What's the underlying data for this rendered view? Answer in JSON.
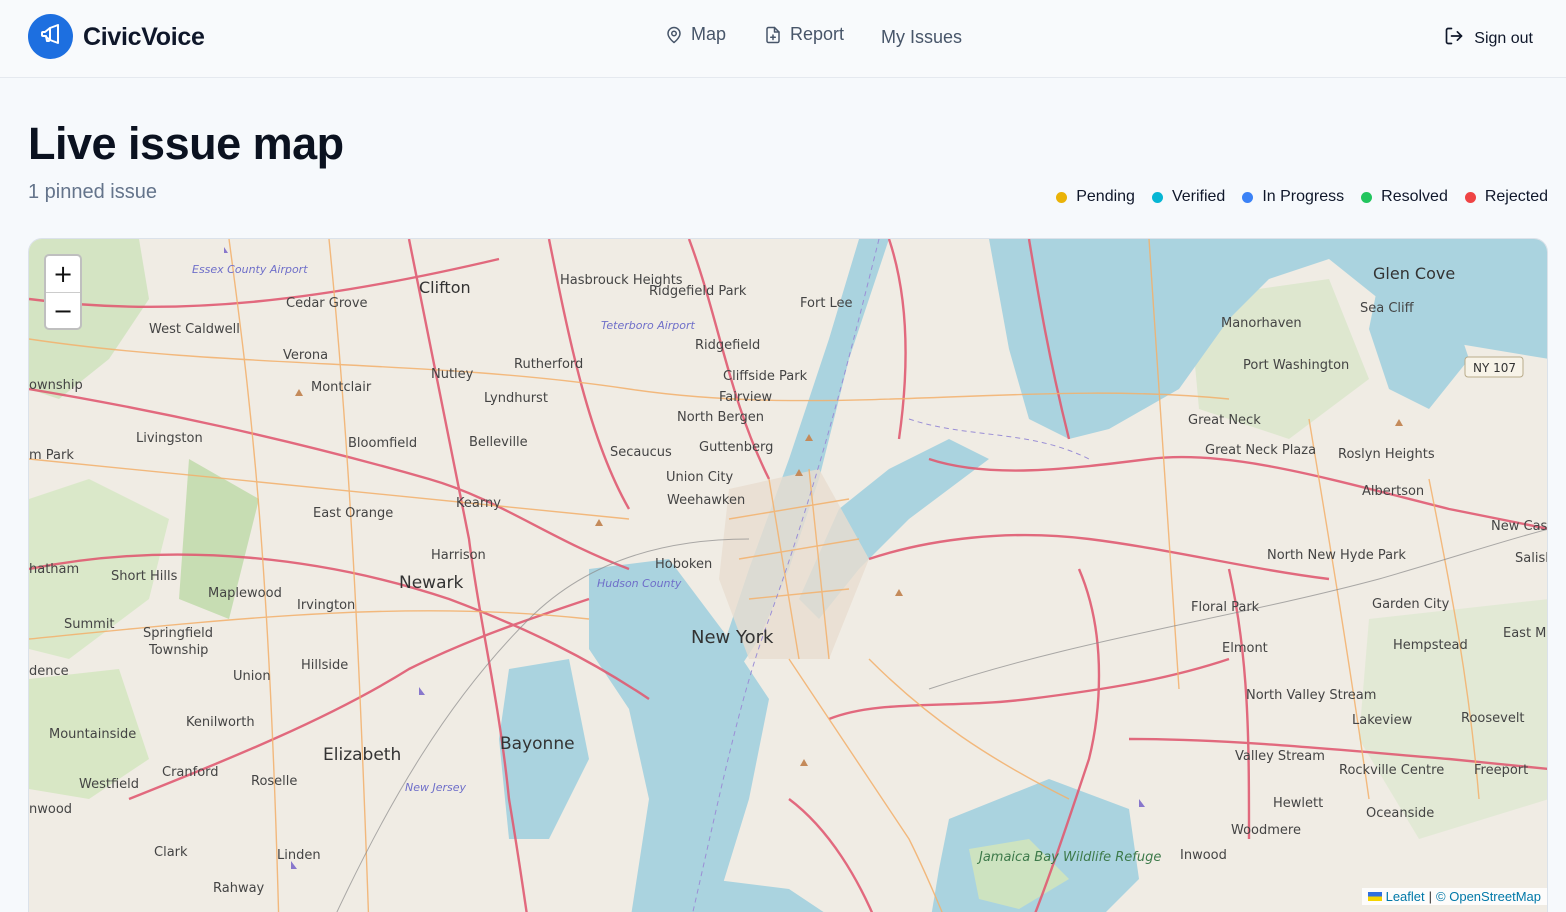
{
  "app": {
    "name": "CivicVoice",
    "logo_icon": "megaphone-icon",
    "accent": "#1d6fe0"
  },
  "nav": [
    {
      "label": "Map",
      "icon": "map-pin-icon"
    },
    {
      "label": "Report",
      "icon": "file-plus-icon"
    },
    {
      "label": "My Issues",
      "icon": ""
    }
  ],
  "signout": {
    "label": "Sign out",
    "icon": "logout-icon"
  },
  "page": {
    "title": "Live issue map",
    "subtitle": "1 pinned issue"
  },
  "legend": [
    {
      "label": "Pending",
      "color": "#eab308"
    },
    {
      "label": "Verified",
      "color": "#06b6d4"
    },
    {
      "label": "In Progress",
      "color": "#3b82f6"
    },
    {
      "label": "Resolved",
      "color": "#22c55e"
    },
    {
      "label": "Rejected",
      "color": "#ef4444"
    }
  ],
  "map": {
    "zoom_in": "+",
    "zoom_out": "−",
    "attribution": {
      "leaflet": "Leaflet",
      "separator": "|",
      "osm": "© OpenStreetMap"
    },
    "places": {
      "newyork": "New York",
      "newark": "Newark",
      "elizabeth": "Elizabeth",
      "bayonne": "Bayonne",
      "clifton": "Clifton",
      "hoboken": "Hoboken",
      "glencove": "Glen Cove",
      "hasbrouck": "Hasbrouck Heights",
      "ridgefieldpark": "Ridgefield Park",
      "fortlee": "Fort Lee",
      "ridgefield": "Ridgefield",
      "cliffside": "Cliffside Park",
      "fairview": "Fairview",
      "northbergen": "North Bergen",
      "guttenberg": "Guttenberg",
      "unioncity": "Union City",
      "weehawken": "Weehawken",
      "secaucus": "Secaucus",
      "rutherford": "Rutherford",
      "lyndhurst": "Lyndhurst",
      "nutley": "Nutley",
      "belleville": "Belleville",
      "bloomfield": "Bloomfield",
      "montclair": "Montclair",
      "verona": "Verona",
      "cedargrove": "Cedar Grove",
      "westcaldwell": "West Caldwell",
      "livingston": "Livingston",
      "eastorange": "East Orange",
      "kearny": "Kearny",
      "harrison": "Harrison",
      "irvington": "Irvington",
      "maplewood": "Maplewood",
      "shorthills": "Short Hills",
      "summit": "Summit",
      "springfield": "Springfield",
      "township": "Township",
      "hillside": "Hillside",
      "union": "Union",
      "kenilworth": "Kenilworth",
      "mountainside": "Mountainside",
      "cranford": "Cranford",
      "westfield": "Westfield",
      "roselle": "Roselle",
      "clark": "Clark",
      "linden": "Linden",
      "rahway": "Rahway",
      "manorhaven": "Manorhaven",
      "seacliff": "Sea Cliff",
      "portwashington": "Port Washington",
      "greatneck": "Great Neck",
      "greatneckplaza": "Great Neck Plaza",
      "roslyn": "Roslyn Heights",
      "albertson": "Albertson",
      "newcas": "New Cas",
      "salis": "Salisl",
      "northnewhydepark": "North New Hyde Park",
      "floralpark": "Floral Park",
      "gardencity": "Garden City",
      "eastm": "East M",
      "elmont": "Elmont",
      "hempstead": "Hempstead",
      "northvalleystream": "North Valley Stream",
      "lakeview": "Lakeview",
      "roosevelt": "Roosevelt",
      "valleystream": "Valley Stream",
      "rockville": "Rockville Centre",
      "freeport": "Freeport",
      "hewlett": "Hewlett",
      "oceanside": "Oceanside",
      "woodmere": "Woodmere",
      "inwood": "Inwood",
      "jamaica": "Jamaica Bay Wildlife Refuge",
      "essex": "Essex County Airport",
      "teterboro": "Teterboro Airport",
      "hudson": "Hudson County",
      "newjersey": "New Jersey",
      "township_l": "ownship",
      "chatham": "hatham",
      "dence": "dence",
      "nwood": "nwood",
      "mpark": "m Park",
      "ny107": "NY 107"
    }
  }
}
